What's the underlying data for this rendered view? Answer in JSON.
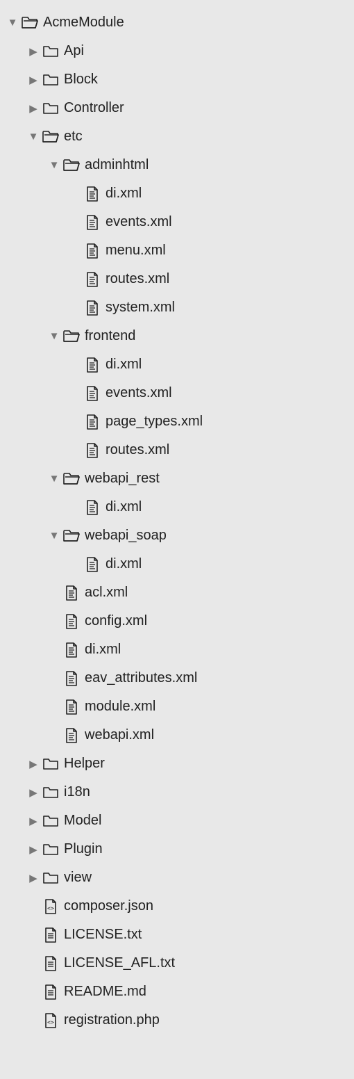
{
  "tree": [
    {
      "depth": 0,
      "arrow": "down",
      "icon": "folder-open",
      "label": "AcmeModule"
    },
    {
      "depth": 1,
      "arrow": "right",
      "icon": "folder-closed",
      "label": "Api"
    },
    {
      "depth": 1,
      "arrow": "right",
      "icon": "folder-closed",
      "label": "Block"
    },
    {
      "depth": 1,
      "arrow": "right",
      "icon": "folder-closed",
      "label": "Controller"
    },
    {
      "depth": 1,
      "arrow": "down",
      "icon": "folder-open",
      "label": "etc"
    },
    {
      "depth": 2,
      "arrow": "down",
      "icon": "folder-open",
      "label": "adminhtml"
    },
    {
      "depth": 3,
      "arrow": "none",
      "icon": "file-xml",
      "label": "di.xml"
    },
    {
      "depth": 3,
      "arrow": "none",
      "icon": "file-xml",
      "label": "events.xml"
    },
    {
      "depth": 3,
      "arrow": "none",
      "icon": "file-xml",
      "label": "menu.xml"
    },
    {
      "depth": 3,
      "arrow": "none",
      "icon": "file-xml",
      "label": "routes.xml"
    },
    {
      "depth": 3,
      "arrow": "none",
      "icon": "file-xml",
      "label": "system.xml"
    },
    {
      "depth": 2,
      "arrow": "down",
      "icon": "folder-open",
      "label": "frontend"
    },
    {
      "depth": 3,
      "arrow": "none",
      "icon": "file-xml",
      "label": "di.xml"
    },
    {
      "depth": 3,
      "arrow": "none",
      "icon": "file-xml",
      "label": "events.xml"
    },
    {
      "depth": 3,
      "arrow": "none",
      "icon": "file-xml",
      "label": "page_types.xml"
    },
    {
      "depth": 3,
      "arrow": "none",
      "icon": "file-xml",
      "label": "routes.xml"
    },
    {
      "depth": 2,
      "arrow": "down",
      "icon": "folder-open",
      "label": "webapi_rest"
    },
    {
      "depth": 3,
      "arrow": "none",
      "icon": "file-xml",
      "label": "di.xml"
    },
    {
      "depth": 2,
      "arrow": "down",
      "icon": "folder-open",
      "label": "webapi_soap"
    },
    {
      "depth": 3,
      "arrow": "none",
      "icon": "file-xml",
      "label": "di.xml"
    },
    {
      "depth": 2,
      "arrow": "none",
      "icon": "file-xml",
      "label": "acl.xml"
    },
    {
      "depth": 2,
      "arrow": "none",
      "icon": "file-xml",
      "label": "config.xml"
    },
    {
      "depth": 2,
      "arrow": "none",
      "icon": "file-xml",
      "label": "di.xml"
    },
    {
      "depth": 2,
      "arrow": "none",
      "icon": "file-xml",
      "label": "eav_attributes.xml"
    },
    {
      "depth": 2,
      "arrow": "none",
      "icon": "file-xml",
      "label": "module.xml"
    },
    {
      "depth": 2,
      "arrow": "none",
      "icon": "file-xml",
      "label": "webapi.xml"
    },
    {
      "depth": 1,
      "arrow": "right",
      "icon": "folder-closed",
      "label": "Helper"
    },
    {
      "depth": 1,
      "arrow": "right",
      "icon": "folder-closed",
      "label": "i18n"
    },
    {
      "depth": 1,
      "arrow": "right",
      "icon": "folder-closed",
      "label": "Model"
    },
    {
      "depth": 1,
      "arrow": "right",
      "icon": "folder-closed",
      "label": "Plugin"
    },
    {
      "depth": 1,
      "arrow": "right",
      "icon": "folder-closed",
      "label": "view"
    },
    {
      "depth": 1,
      "arrow": "none",
      "icon": "file-code",
      "label": "composer.json"
    },
    {
      "depth": 1,
      "arrow": "none",
      "icon": "file-text",
      "label": "LICENSE.txt"
    },
    {
      "depth": 1,
      "arrow": "none",
      "icon": "file-text",
      "label": "LICENSE_AFL.txt"
    },
    {
      "depth": 1,
      "arrow": "none",
      "icon": "file-text",
      "label": "README.md"
    },
    {
      "depth": 1,
      "arrow": "none",
      "icon": "file-code",
      "label": "registration.php"
    }
  ]
}
